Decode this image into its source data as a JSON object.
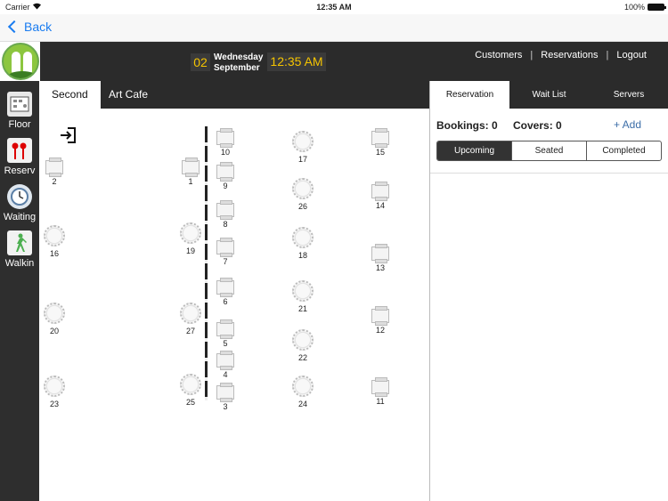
{
  "status_bar": {
    "carrier": "Carrier",
    "time": "12:35 AM",
    "battery": "100%"
  },
  "nav": {
    "back_label": "Back"
  },
  "header": {
    "day": "02",
    "weekday": "Wednesday",
    "month": "September",
    "clock": "12:35 AM",
    "links": [
      "Customers",
      "Reservations",
      "Logout"
    ]
  },
  "sidebar": {
    "items": [
      {
        "label": "Floor",
        "icon": "floor-plan-icon"
      },
      {
        "label": "Reserv",
        "icon": "cutlery-icon"
      },
      {
        "label": "Waiting",
        "icon": "clock-icon"
      },
      {
        "label": "Walkin",
        "icon": "walking-person-icon"
      }
    ]
  },
  "floor_tabs": [
    "Second",
    "Art Cafe"
  ],
  "floor": {
    "tables": [
      {
        "num": "2",
        "shape": "square",
        "col": 0,
        "row": 0
      },
      {
        "num": "1",
        "shape": "square",
        "col": 1,
        "row": 0
      },
      {
        "num": "10",
        "shape": "square",
        "col": 2,
        "row": 0
      },
      {
        "num": "17",
        "shape": "round",
        "col": 3,
        "row": 0
      },
      {
        "num": "15",
        "shape": "square",
        "col": 4,
        "row": 0
      },
      {
        "num": "9",
        "shape": "square",
        "col": 2,
        "row": 1
      },
      {
        "num": "26",
        "shape": "round",
        "col": 3,
        "row": 1
      },
      {
        "num": "14",
        "shape": "square",
        "col": 4,
        "row": 1
      },
      {
        "num": "8",
        "shape": "square",
        "col": 2,
        "row": 2
      },
      {
        "num": "16",
        "shape": "round",
        "col": 0,
        "row": 2
      },
      {
        "num": "19",
        "shape": "round",
        "col": 1,
        "row": 2
      },
      {
        "num": "7",
        "shape": "square",
        "col": 2,
        "row": 3
      },
      {
        "num": "18",
        "shape": "round",
        "col": 3,
        "row": 3
      },
      {
        "num": "13",
        "shape": "square",
        "col": 4,
        "row": 3
      },
      {
        "num": "6",
        "shape": "square",
        "col": 2,
        "row": 4
      },
      {
        "num": "21",
        "shape": "round",
        "col": 3,
        "row": 4
      },
      {
        "num": "20",
        "shape": "round",
        "col": 0,
        "row": 4
      },
      {
        "num": "27",
        "shape": "round",
        "col": 1,
        "row": 4
      },
      {
        "num": "12",
        "shape": "square",
        "col": 4,
        "row": 4
      },
      {
        "num": "5",
        "shape": "square",
        "col": 2,
        "row": 5
      },
      {
        "num": "22",
        "shape": "round",
        "col": 3,
        "row": 5
      },
      {
        "num": "4",
        "shape": "square",
        "col": 2,
        "row": 6
      },
      {
        "num": "23",
        "shape": "round",
        "col": 0,
        "row": 6
      },
      {
        "num": "25",
        "shape": "round",
        "col": 1,
        "row": 6
      },
      {
        "num": "3",
        "shape": "square",
        "col": 2,
        "row": 7
      },
      {
        "num": "24",
        "shape": "round",
        "col": 3,
        "row": 7
      },
      {
        "num": "11",
        "shape": "square",
        "col": 4,
        "row": 7
      }
    ]
  },
  "panel": {
    "tabs": [
      "Reservation",
      "Wait List",
      "Servers"
    ],
    "bookings_label": "Bookings: 0",
    "covers_label": "Covers: 0",
    "add_label": "+ Add",
    "segments": [
      "Upcoming",
      "Seated",
      "Completed"
    ]
  }
}
